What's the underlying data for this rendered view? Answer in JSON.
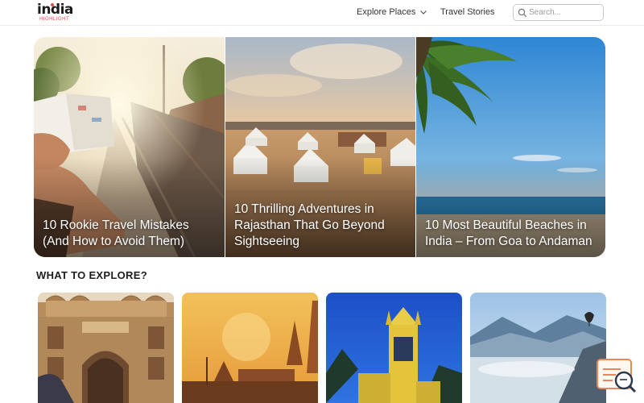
{
  "header": {
    "logo_main": "india",
    "logo_sub": "HIGHLIGHT",
    "nav": {
      "explore_label": "Explore Places",
      "stories_label": "Travel Stories"
    },
    "search": {
      "placeholder": "Search...",
      "value": ""
    }
  },
  "hero": {
    "cards": [
      {
        "title": "10 Rookie Travel Mistakes (And How to Avoid Them)"
      },
      {
        "title": "10 Thrilling Adventures in Rajasthan That Go Beyond Sightseeing"
      },
      {
        "title": "10 Most Beautiful Beaches in India – From Goa to Andaman"
      }
    ]
  },
  "explore": {
    "title": "WHAT TO EXPLORE?",
    "cards": [
      {
        "icon": "fort-palace-image"
      },
      {
        "icon": "temple-sunset-image"
      },
      {
        "icon": "church-tower-image"
      },
      {
        "icon": "mountain-valley-image"
      }
    ]
  },
  "theme": {
    "accent": "#e24a4a",
    "chat_accent": "#e8875a",
    "chat_dark": "#2b3a4a"
  }
}
